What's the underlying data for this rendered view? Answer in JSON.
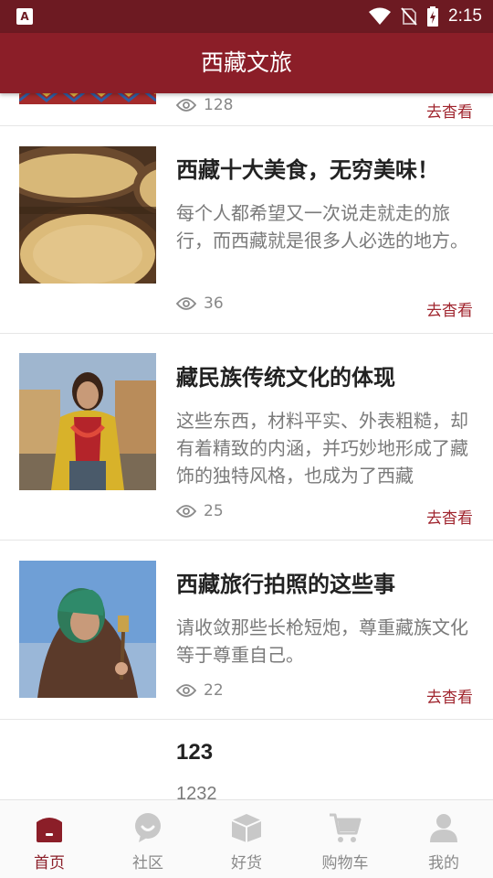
{
  "status_bar": {
    "time": "2:15",
    "app_badge": "A"
  },
  "app_bar": {
    "title": "西藏文旅"
  },
  "articles": [
    {
      "title": "",
      "desc": "",
      "views": "128",
      "link": "去杳看"
    },
    {
      "title": "西藏十大美食，无穷美味！",
      "desc": "每个人都希望又一次说走就走的旅行，而西藏就是很多人必选的地方。",
      "views": "36",
      "link": "去杳看"
    },
    {
      "title": "藏民族传统文化的体现",
      "desc": "这些东西，材料平实、外表粗糙，却有着精致的内涵，并巧妙地形成了藏饰的独特风格，也成为了西藏",
      "views": "25",
      "link": "去杳看"
    },
    {
      "title": "西藏旅行拍照的这些事",
      "desc": "请收敛那些长枪短炮，尊重藏族文化等于尊重自己。",
      "views": "22",
      "link": "去杳看"
    },
    {
      "title": "123",
      "desc": "1232",
      "views": "",
      "link": ""
    }
  ],
  "tabs": [
    {
      "label": "首页",
      "icon": "home-icon"
    },
    {
      "label": "社区",
      "icon": "chat-icon"
    },
    {
      "label": "好货",
      "icon": "box-icon"
    },
    {
      "label": "购物车",
      "icon": "cart-icon"
    },
    {
      "label": "我的",
      "icon": "user-icon"
    }
  ],
  "colors": {
    "primary": "#8b1e28",
    "status_bar": "#6d1a22",
    "link": "#a0252e",
    "tab_inactive": "#c8c8c8"
  }
}
